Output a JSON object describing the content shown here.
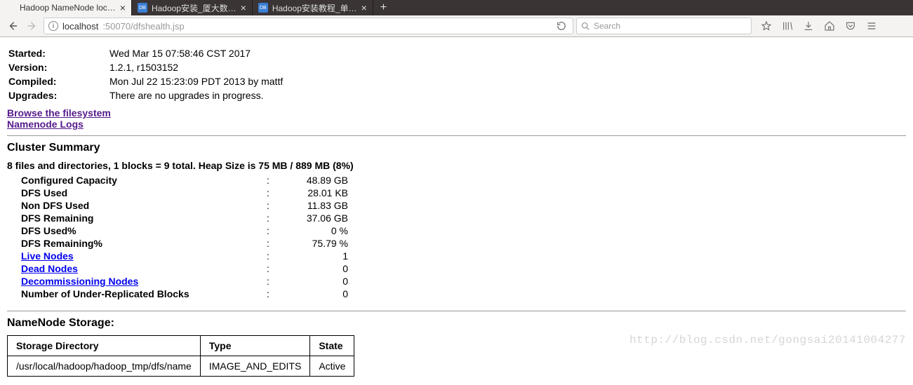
{
  "tabs": [
    {
      "label": "Hadoop NameNode loc…",
      "active": true
    },
    {
      "label": "Hadoop安装_厦大数…",
      "active": false
    },
    {
      "label": "Hadoop安装教程_单…",
      "active": false
    }
  ],
  "url": {
    "host": "localhost",
    "path": ":50070/dfshealth.jsp"
  },
  "search_placeholder": "Search",
  "info": {
    "started_label": "Started:",
    "started_value": "Wed Mar 15 07:58:46 CST 2017",
    "version_label": "Version:",
    "version_value": "1.2.1, r1503152",
    "compiled_label": "Compiled:",
    "compiled_value": "Mon Jul 22 15:23:09 PDT 2013 by mattf",
    "upgrades_label": "Upgrades:",
    "upgrades_value": "There are no upgrades in progress."
  },
  "links": {
    "browse_fs": "Browse the filesystem",
    "nn_logs": "Namenode Logs"
  },
  "cluster_summary_heading": "Cluster Summary",
  "summary_line": "8 files and directories, 1 blocks = 9 total. Heap Size is 75 MB / 889 MB (8%)",
  "stats": [
    {
      "label": "Configured Capacity",
      "value": "48.89 GB",
      "link": false
    },
    {
      "label": "DFS Used",
      "value": "28.01 KB",
      "link": false
    },
    {
      "label": "Non DFS Used",
      "value": "11.83 GB",
      "link": false
    },
    {
      "label": "DFS Remaining",
      "value": "37.06 GB",
      "link": false
    },
    {
      "label": "DFS Used%",
      "value": "0 %",
      "link": false
    },
    {
      "label": "DFS Remaining%",
      "value": "75.79 %",
      "link": false
    },
    {
      "label": "Live Nodes",
      "value": "1",
      "link": true
    },
    {
      "label": "Dead Nodes",
      "value": "0",
      "link": true
    },
    {
      "label": "Decommissioning Nodes",
      "value": "0",
      "link": true
    },
    {
      "label": "Number of Under-Replicated Blocks",
      "value": "0",
      "link": false
    }
  ],
  "storage_heading": "NameNode Storage:",
  "storage_headers": {
    "dir": "Storage Directory",
    "type": "Type",
    "state": "State"
  },
  "storage_row": {
    "dir": "/usr/local/hadoop/hadoop_tmp/dfs/name",
    "type": "IMAGE_AND_EDITS",
    "state": "Active"
  },
  "watermark": "http://blog.csdn.net/gongsai20141004277"
}
